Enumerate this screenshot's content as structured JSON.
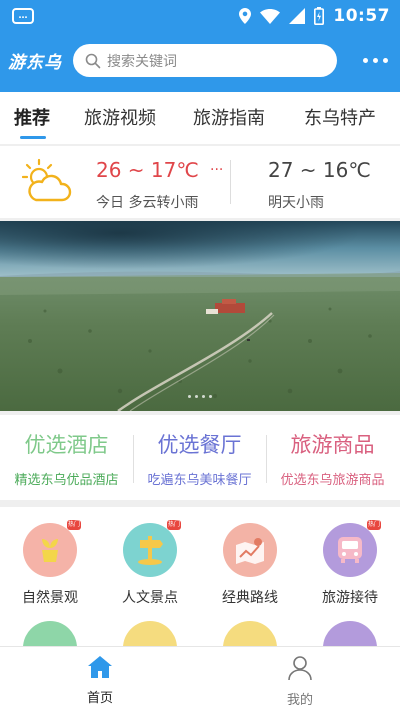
{
  "status_bar": {
    "time": "10:57",
    "left_icon": "message-icon",
    "icons": [
      "location-icon",
      "wifi-icon",
      "signal-icon",
      "battery-icon"
    ]
  },
  "header": {
    "logo": "游东乌",
    "search_placeholder": "搜索关键词",
    "more_icon": "more-icon"
  },
  "tabs": [
    {
      "label": "推荐",
      "active": true
    },
    {
      "label": "旅游视频"
    },
    {
      "label": "旅游指南"
    },
    {
      "label": "东乌特产"
    }
  ],
  "weather": {
    "icon": "cloudy-sun-icon",
    "today_temp": "26 ~ 17℃",
    "today_more": "...",
    "today_desc": "今日 多云转小雨",
    "tomorrow_temp": "27 ~ 16℃",
    "tomorrow_desc": "明天小雨"
  },
  "banner": {
    "dot_count": 4
  },
  "categories": [
    {
      "title": "优选酒店",
      "subtitle": "精选东乌优品酒店",
      "title_color": "#7fc98a",
      "subtitle_color": "#4cab5a"
    },
    {
      "title": "优选餐厅",
      "subtitle": "吃遍东乌美味餐厅",
      "title_color": "#6a73d4",
      "subtitle_color": "#6a73d4"
    },
    {
      "title": "旅游商品",
      "subtitle": "优选东乌旅游商品",
      "title_color": "#d9607f",
      "subtitle_color": "#d9607f"
    }
  ],
  "grid_items": [
    {
      "label": "自然景观",
      "color": "#f5b3a8",
      "icon": "plant-pot-icon",
      "badge": "热门"
    },
    {
      "label": "人文景点",
      "color": "#7dd3d0",
      "icon": "signpost-icon",
      "badge": "热门"
    },
    {
      "label": "经典路线",
      "color": "#f3b3a6",
      "icon": "map-route-icon",
      "badge": ""
    },
    {
      "label": "旅游接待",
      "color": "#b39bdc",
      "icon": "bus-icon",
      "badge": "热门"
    }
  ],
  "grid_row2_colors": [
    "#8ed6a8",
    "#f5dc7f",
    "#f5dc7f",
    "#b39bdc"
  ],
  "bottom_nav": [
    {
      "label": "首页",
      "icon": "home-icon",
      "active": true
    },
    {
      "label": "我的",
      "icon": "user-icon",
      "active": false
    }
  ],
  "colors": {
    "primary": "#2f98ea",
    "today_temp": "#e0464a"
  }
}
